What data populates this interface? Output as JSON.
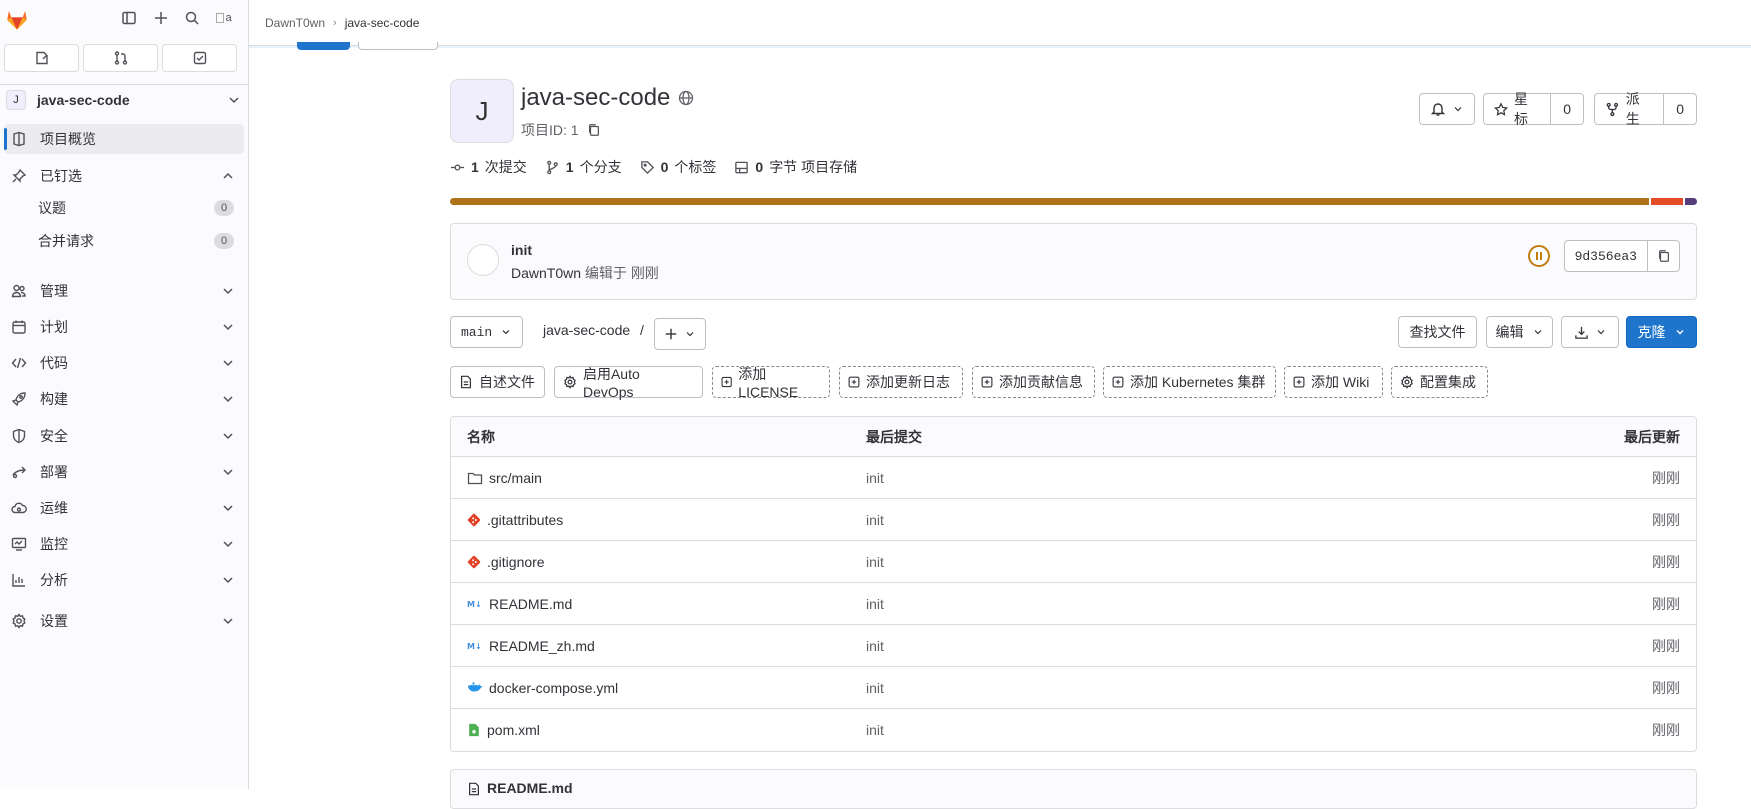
{
  "breadcrumb": {
    "owner": "DawnT0wn",
    "project": "java-sec-code"
  },
  "sidebar": {
    "avatar_alt": "a",
    "project": {
      "initial": "J",
      "name": "java-sec-code"
    },
    "items": [
      {
        "label": "项目概览"
      },
      {
        "label": "已钉选"
      },
      {
        "label": "管理"
      },
      {
        "label": "计划"
      },
      {
        "label": "代码"
      },
      {
        "label": "构建"
      },
      {
        "label": "安全"
      },
      {
        "label": "部署"
      },
      {
        "label": "运维"
      },
      {
        "label": "监控"
      },
      {
        "label": "分析"
      },
      {
        "label": "设置"
      }
    ],
    "pinned": [
      {
        "label": "议题",
        "count": "0"
      },
      {
        "label": "合并请求",
        "count": "0"
      }
    ]
  },
  "project": {
    "initial": "J",
    "name": "java-sec-code",
    "id_label": "项目ID: 1",
    "star_label": "星标",
    "star_count": "0",
    "fork_label": "派生",
    "fork_count": "0"
  },
  "stats": {
    "commits": "1",
    "commits_label": "次提交",
    "branches": "1",
    "branches_label": "个分支",
    "tags": "0",
    "tags_label": "个标签",
    "storage": "0",
    "storage_label": "字节 项目存储"
  },
  "languages": [
    {
      "color": "#b07219",
      "share": 0.965
    },
    {
      "color": "#e34c26",
      "share": 0.025
    },
    {
      "color": "#563d7c",
      "share": 0.01
    }
  ],
  "commit": {
    "message": "init",
    "author": "DawnT0wn",
    "action": "编辑于",
    "time": "刚刚",
    "sha": "9d356ea3"
  },
  "toolbar": {
    "branch": "main",
    "path": "java-sec-code",
    "path_sep": "/",
    "find_file": "查找文件",
    "edit": "编辑",
    "clone": "克隆"
  },
  "quick_actions": [
    "自述文件",
    "启用Auto DevOps",
    "添加LICENSE",
    "添加更新日志",
    "添加贡献信息",
    "添加 Kubernetes 集群",
    "添加 Wiki",
    "配置集成"
  ],
  "table": {
    "headers": {
      "name": "名称",
      "last_commit": "最后提交",
      "last_update": "最后更新"
    },
    "rows": [
      {
        "icon": "folder-icon",
        "name": "src/main",
        "commit": "init",
        "updated": "刚刚"
      },
      {
        "icon": "git-icon",
        "name": ".gitattributes",
        "commit": "init",
        "updated": "刚刚"
      },
      {
        "icon": "git-icon",
        "name": ".gitignore",
        "commit": "init",
        "updated": "刚刚"
      },
      {
        "icon": "markdown-icon",
        "name": "README.md",
        "commit": "init",
        "updated": "刚刚"
      },
      {
        "icon": "markdown-icon",
        "name": "README_zh.md",
        "commit": "init",
        "updated": "刚刚"
      },
      {
        "icon": "docker-icon",
        "name": "docker-compose.yml",
        "commit": "init",
        "updated": "刚刚"
      },
      {
        "icon": "xml-file-icon",
        "name": "pom.xml",
        "commit": "init",
        "updated": "刚刚"
      }
    ]
  },
  "readme": {
    "title": "README.md"
  }
}
